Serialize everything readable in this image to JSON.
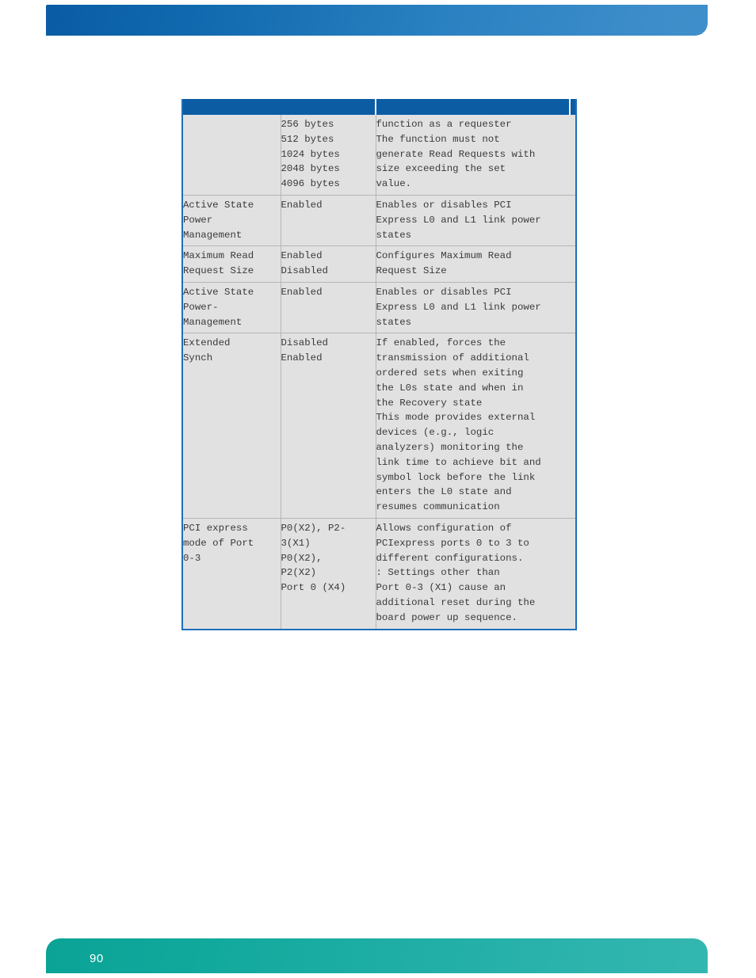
{
  "page": {
    "number": "90",
    "header_accent_color": "#0b5ca3",
    "footer_accent_color": "#12a99d",
    "link_text_color": "#6594c6",
    "table_border_color": "#1f6fba",
    "cell_background_color": "#e1e1e1"
  },
  "table": {
    "header": {
      "col1": "",
      "col2": "",
      "col3": ""
    },
    "rows": [
      {
        "name": "",
        "value": "256 bytes\n512 bytes\n1024 bytes\n2048 bytes\n4096 bytes",
        "description": "function as a requester\nThe function must not\ngenerate Read Requests with\nsize exceeding the set\nvalue."
      },
      {
        "name": "Active State\nPower\nManagement",
        "value": "Enabled",
        "description": "Enables or disables PCI\nExpress L0 and L1 link power\nstates"
      },
      {
        "name": "Maximum Read\nRequest Size",
        "value": "Enabled\nDisabled",
        "description": "Configures Maximum Read\nRequest Size"
      },
      {
        "name": "Active State\nPower-\nManagement",
        "value": "Enabled",
        "description": "Enables or disables PCI\nExpress L0 and L1 link power\nstates"
      },
      {
        "name": "Extended\nSynch",
        "value": "Disabled\nEnabled",
        "description": "If enabled, forces the\ntransmission of additional\nordered sets when exiting\nthe L0s state and when in\nthe Recovery state\nThis mode provides external\ndevices (e.g.,  logic\nanalyzers) monitoring the\nlink time to achieve bit and\nsymbol lock before the link\nenters  the L0 state and\nresumes communication"
      },
      {
        "name": "PCI express\nmode of Port\n0-3",
        "value": "P0(X2), P2-\n3(X1)\nP0(X2),\nP2(X2)\nPort 0 (X4)",
        "description": "Allows configuration of\nPCIexpress ports 0 to 3 to\ndifferent configurations.\n        : Settings other than\nPort 0-3 (X1) cause an\nadditional reset during the\nboard power up sequence."
      }
    ]
  }
}
